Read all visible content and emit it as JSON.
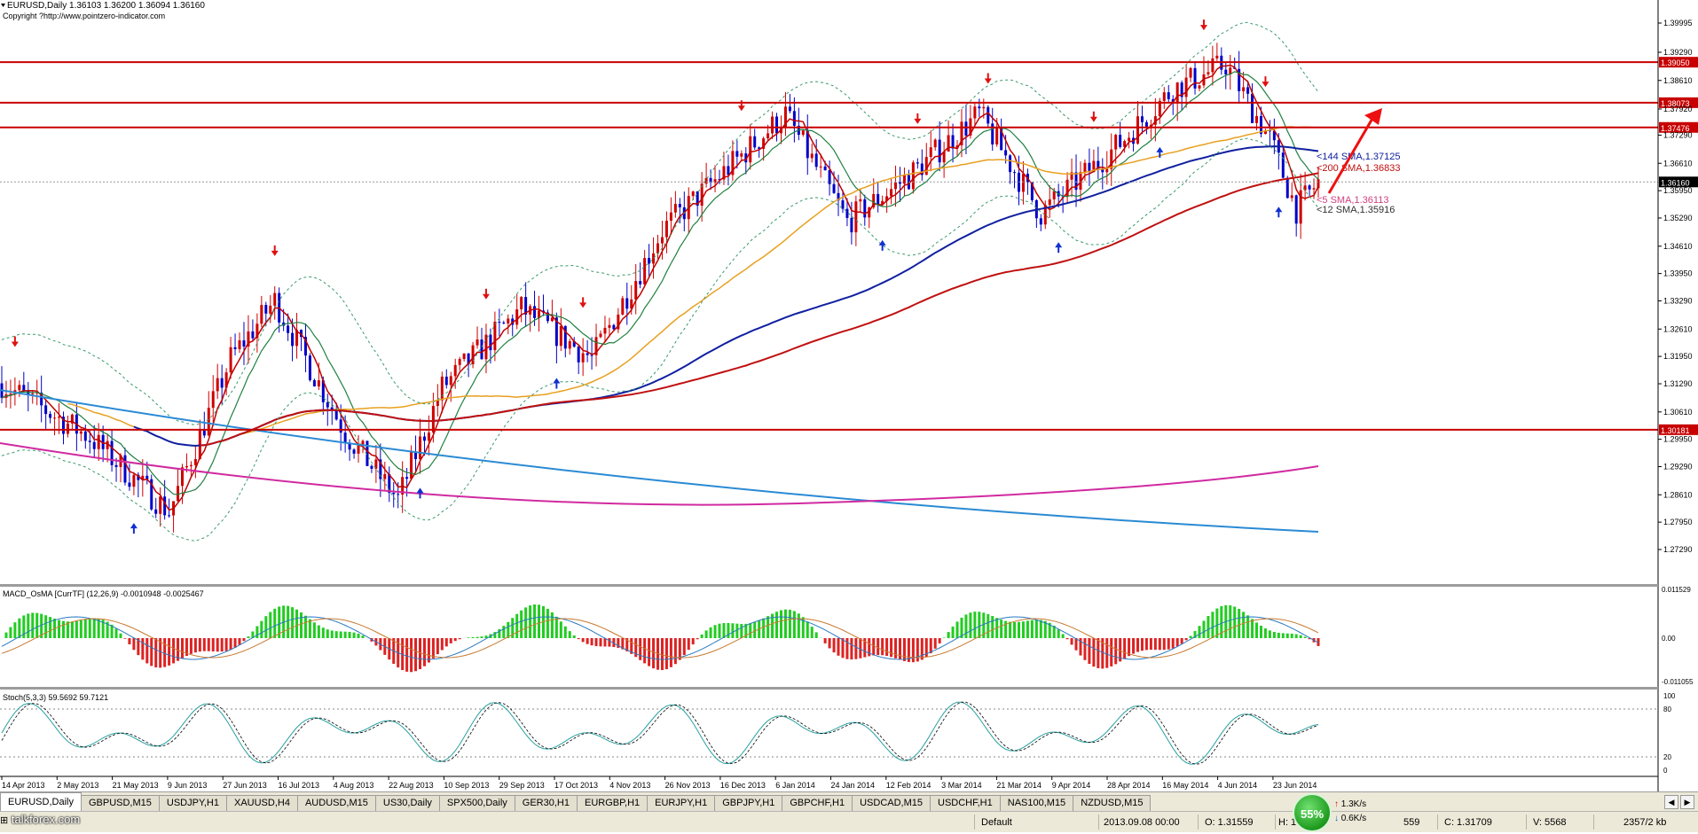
{
  "header": {
    "symbol_line": "EURUSD,Daily  1.36103 1.36200 1.36094 1.36160",
    "copyright": "Copyright ?http://www.pointzero-indicator.com"
  },
  "colors": {
    "bull": "#d00000",
    "bear": "#0000c8",
    "resistance": "#c80000",
    "sma5": "#d04080",
    "sma12": "#303030",
    "sma144": "#1020a0",
    "sma200": "#c01010",
    "sma_orange": "#e8a020",
    "long_blue": "#2a8ad4",
    "long_magenta": "#d02aa0",
    "macd_up": "#22cc22",
    "macd_dn": "#dd2222",
    "stoch": "#2aa0a0"
  },
  "price_axis": {
    "labels": [
      "1.39995",
      "1.39290",
      "1.38610",
      "1.37920",
      "1.37290",
      "1.36610",
      "1.35950",
      "1.35290",
      "1.34610",
      "1.33950",
      "1.33290",
      "1.32610",
      "1.31950",
      "1.31290",
      "1.30610",
      "1.29950",
      "1.29290",
      "1.28610",
      "1.27950",
      "1.27290"
    ],
    "levels": [
      {
        "label": "1.39050",
        "value": 1.3905
      },
      {
        "label": "1.38073",
        "value": 1.38073
      },
      {
        "label": "1.37476",
        "value": 1.37476
      },
      {
        "label": "1.30181",
        "value": 1.30181
      }
    ],
    "current": "1.36160"
  },
  "annotations": {
    "sma144": "<144 SMA,1.37125",
    "sma200": "<200 SMA,1.36833",
    "sma5": "<5 SMA,1.36113",
    "sma12": "<12 SMA,1.35916"
  },
  "macd": {
    "title": "MACD_OsMA [CurrTF] (12,26,9) -0.0010948 -0.0025467",
    "axis": [
      "0.011529",
      "0.00",
      "-0.011055"
    ]
  },
  "stoch": {
    "title": "Stoch(5,3,3) 59.5692 59.7121",
    "axis": [
      "100",
      "80",
      "20",
      "0"
    ]
  },
  "date_axis": [
    "14 Apr 2013",
    "2 May 2013",
    "21 May 2013",
    "9 Jun 2013",
    "27 Jun 2013",
    "16 Jul 2013",
    "4 Aug 2013",
    "22 Aug 2013",
    "10 Sep 2013",
    "29 Sep 2013",
    "17 Oct 2013",
    "4 Nov 2013",
    "26 Nov 2013",
    "16 Dec 2013",
    "6 Jan 2014",
    "24 Jan 2014",
    "12 Feb 2014",
    "3 Mar 2014",
    "21 Mar 2014",
    "9 Apr 2014",
    "28 Apr 2014",
    "16 May 2014",
    "4 Jun 2014",
    "23 Jun 2014"
  ],
  "tabs": [
    "EURUSD,Daily",
    "GBPUSD,M15",
    "USDJPY,H1",
    "XAUUSD,H4",
    "AUDUSD,M15",
    "US30,Daily",
    "SPX500,Daily",
    "GER30,H1",
    "EURGBP,H1",
    "EURJPY,H1",
    "GBPJPY,H1",
    "GBPCHF,H1",
    "USDCAD,M15",
    "USDCHF,H1",
    "NAS100,M15",
    "NZDUSD,M15"
  ],
  "status": {
    "profile": "Default",
    "datetime": "2013.09.08 00:00",
    "open": "O: 1.31559",
    "high": "H: 1.",
    "low": "559",
    "close": "C: 1.31709",
    "volume": "V: 5568",
    "traffic": "2357/2 kb",
    "badge": "55%",
    "up_speed": "1.3K/s",
    "down_speed": "0.6K/s",
    "watermark": "talkforex.com"
  }
}
